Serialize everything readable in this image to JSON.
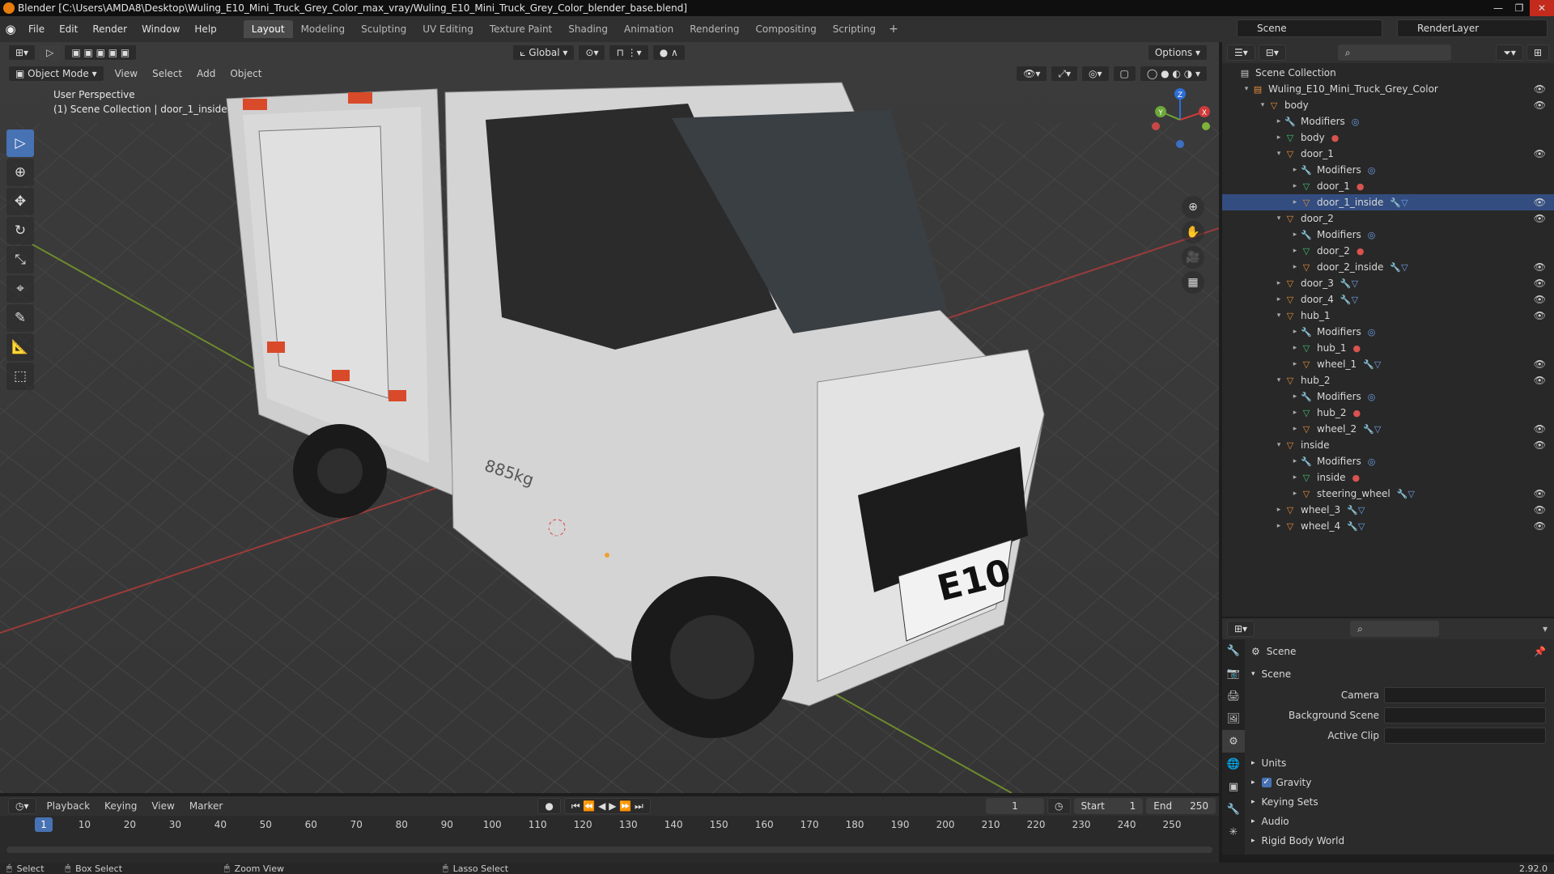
{
  "window": {
    "title": "Blender [C:\\Users\\AMDA8\\Desktop\\Wuling_E10_Mini_Truck_Grey_Color_max_vray/Wuling_E10_Mini_Truck_Grey_Color_blender_base.blend]"
  },
  "menu": [
    "File",
    "Edit",
    "Render",
    "Window",
    "Help"
  ],
  "workspaces": [
    "Layout",
    "Modeling",
    "Sculpting",
    "UV Editing",
    "Texture Paint",
    "Shading",
    "Animation",
    "Rendering",
    "Compositing",
    "Scripting"
  ],
  "active_workspace": "Layout",
  "scene_selector": "Scene",
  "view_layer": "RenderLayer",
  "viewport": {
    "mode": "Object Mode",
    "menus": [
      "View",
      "Select",
      "Add",
      "Object"
    ],
    "transform_orientation": "Global",
    "options_label": "Options",
    "perspective_label": "User Perspective",
    "collection_label": "(1) Scene Collection | door_1_inside",
    "tools": [
      "select-box",
      "cursor",
      "move",
      "rotate",
      "scale",
      "transform",
      "annotate",
      "measure",
      "add-cube"
    ],
    "truck_side_text": "885kg",
    "truck_plate": "E10",
    "gizmo_axes": [
      "X",
      "Y",
      "Z"
    ]
  },
  "outliner": {
    "root": "Scene Collection",
    "items": [
      {
        "label": "Wuling_E10_Mini_Truck_Grey_Color",
        "indent": 0,
        "kind": "collection",
        "tri": "▾",
        "eye": true
      },
      {
        "label": "body",
        "indent": 1,
        "kind": "obj",
        "tri": "▾",
        "eye": true
      },
      {
        "label": "Modifiers",
        "indent": 2,
        "kind": "mod",
        "tri": "▸",
        "eye": false
      },
      {
        "label": "body",
        "indent": 2,
        "kind": "mesh",
        "tri": "▸",
        "eye": false
      },
      {
        "label": "door_1",
        "indent": 2,
        "kind": "obj",
        "tri": "▾",
        "eye": true
      },
      {
        "label": "Modifiers",
        "indent": 3,
        "kind": "mod",
        "tri": "▸",
        "eye": false
      },
      {
        "label": "door_1",
        "indent": 3,
        "kind": "mesh",
        "tri": "▸",
        "eye": false
      },
      {
        "label": "door_1_inside",
        "indent": 3,
        "kind": "obj",
        "tri": "▸",
        "eye": true
      },
      {
        "label": "door_2",
        "indent": 2,
        "kind": "obj",
        "tri": "▾",
        "eye": true
      },
      {
        "label": "Modifiers",
        "indent": 3,
        "kind": "mod",
        "tri": "▸",
        "eye": false
      },
      {
        "label": "door_2",
        "indent": 3,
        "kind": "mesh",
        "tri": "▸",
        "eye": false
      },
      {
        "label": "door_2_inside",
        "indent": 3,
        "kind": "obj",
        "tri": "▸",
        "eye": true
      },
      {
        "label": "door_3",
        "indent": 2,
        "kind": "obj",
        "tri": "▸",
        "eye": true
      },
      {
        "label": "door_4",
        "indent": 2,
        "kind": "obj",
        "tri": "▸",
        "eye": true
      },
      {
        "label": "hub_1",
        "indent": 2,
        "kind": "obj",
        "tri": "▾",
        "eye": true
      },
      {
        "label": "Modifiers",
        "indent": 3,
        "kind": "mod",
        "tri": "▸",
        "eye": false
      },
      {
        "label": "hub_1",
        "indent": 3,
        "kind": "mesh",
        "tri": "▸",
        "eye": false
      },
      {
        "label": "wheel_1",
        "indent": 3,
        "kind": "obj",
        "tri": "▸",
        "eye": true
      },
      {
        "label": "hub_2",
        "indent": 2,
        "kind": "obj",
        "tri": "▾",
        "eye": true
      },
      {
        "label": "Modifiers",
        "indent": 3,
        "kind": "mod",
        "tri": "▸",
        "eye": false
      },
      {
        "label": "hub_2",
        "indent": 3,
        "kind": "mesh",
        "tri": "▸",
        "eye": false
      },
      {
        "label": "wheel_2",
        "indent": 3,
        "kind": "obj",
        "tri": "▸",
        "eye": true
      },
      {
        "label": "inside",
        "indent": 2,
        "kind": "obj",
        "tri": "▾",
        "eye": true
      },
      {
        "label": "Modifiers",
        "indent": 3,
        "kind": "mod",
        "tri": "▸",
        "eye": false
      },
      {
        "label": "inside",
        "indent": 3,
        "kind": "mesh",
        "tri": "▸",
        "eye": false
      },
      {
        "label": "steering_wheel",
        "indent": 3,
        "kind": "obj",
        "tri": "▸",
        "eye": true
      },
      {
        "label": "wheel_3",
        "indent": 2,
        "kind": "obj",
        "tri": "▸",
        "eye": true
      },
      {
        "label": "wheel_4",
        "indent": 2,
        "kind": "obj",
        "tri": "▸",
        "eye": true
      }
    ]
  },
  "properties": {
    "context": "Scene",
    "panel": "Scene",
    "fields": [
      {
        "label": "Camera"
      },
      {
        "label": "Background Scene"
      },
      {
        "label": "Active Clip"
      }
    ],
    "collapsed_panels": [
      "Units",
      "Gravity",
      "Keying Sets",
      "Audio",
      "Rigid Body World"
    ],
    "gravity_checked": true
  },
  "timeline": {
    "menus": [
      "Playback",
      "Keying",
      "View",
      "Marker"
    ],
    "current_frame": "1",
    "start_label": "Start",
    "start": "1",
    "end_label": "End",
    "end": "250",
    "ticks": [
      10,
      20,
      30,
      40,
      50,
      60,
      70,
      80,
      90,
      100,
      110,
      120,
      130,
      140,
      150,
      160,
      170,
      180,
      190,
      200,
      210,
      220,
      230,
      240,
      250
    ]
  },
  "status": {
    "items": [
      "Select",
      "Box Select",
      "Zoom View",
      "Lasso Select"
    ],
    "version": "2.92.0"
  },
  "colors": {
    "accent": "#4772b3",
    "object": "#e88d3a",
    "mesh": "#3fc26f",
    "grid_x": "#9b3b3b",
    "grid_y": "#6e8a2d"
  }
}
